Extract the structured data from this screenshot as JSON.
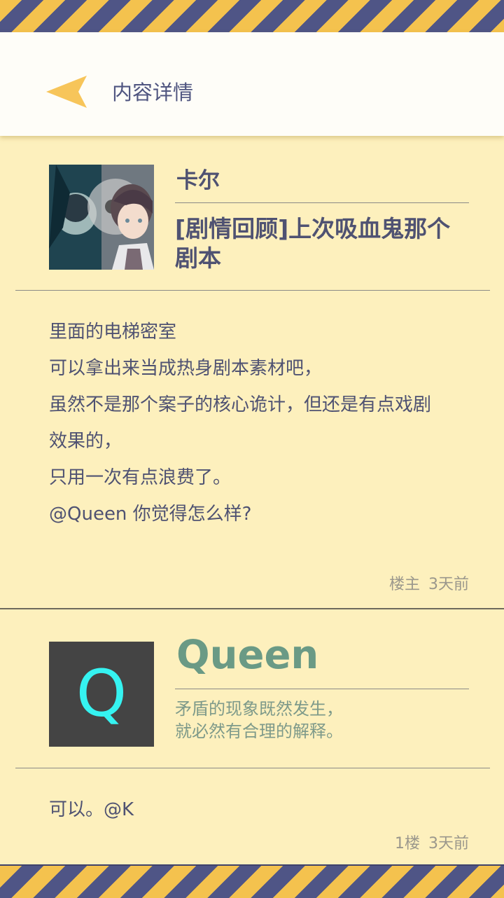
{
  "header": {
    "title": "内容详情"
  },
  "post": {
    "author": "卡尔",
    "title": "[剧情回顾]上次吸血鬼那个剧本",
    "body_lines": [
      "里面的电梯密室",
      "可以拿出来当成热身剧本素材吧，",
      "虽然不是那个案子的核心诡计，但还是有点戏剧",
      "效果的，",
      "只用一次有点浪费了。",
      "@Queen 你觉得怎么样?"
    ],
    "floor": "楼主",
    "time": "3天前"
  },
  "reply": {
    "avatar_letter": "Q",
    "name": "Queen",
    "signature_lines": [
      "矛盾的现象既然发生，",
      "就必然有合理的解释。"
    ],
    "body": "可以。@K",
    "floor": "1楼",
    "time": "3天前"
  },
  "colors": {
    "background": "#fdf0bd",
    "stripe_yellow": "#f4c24e",
    "stripe_navy": "#4f5586",
    "text_dark": "#4f5272",
    "accent_green": "#6a9a85",
    "avatar_letter": "#35f3f1",
    "back_arrow": "#f7c55a"
  },
  "icons": {
    "back": "back-arrow-icon"
  }
}
